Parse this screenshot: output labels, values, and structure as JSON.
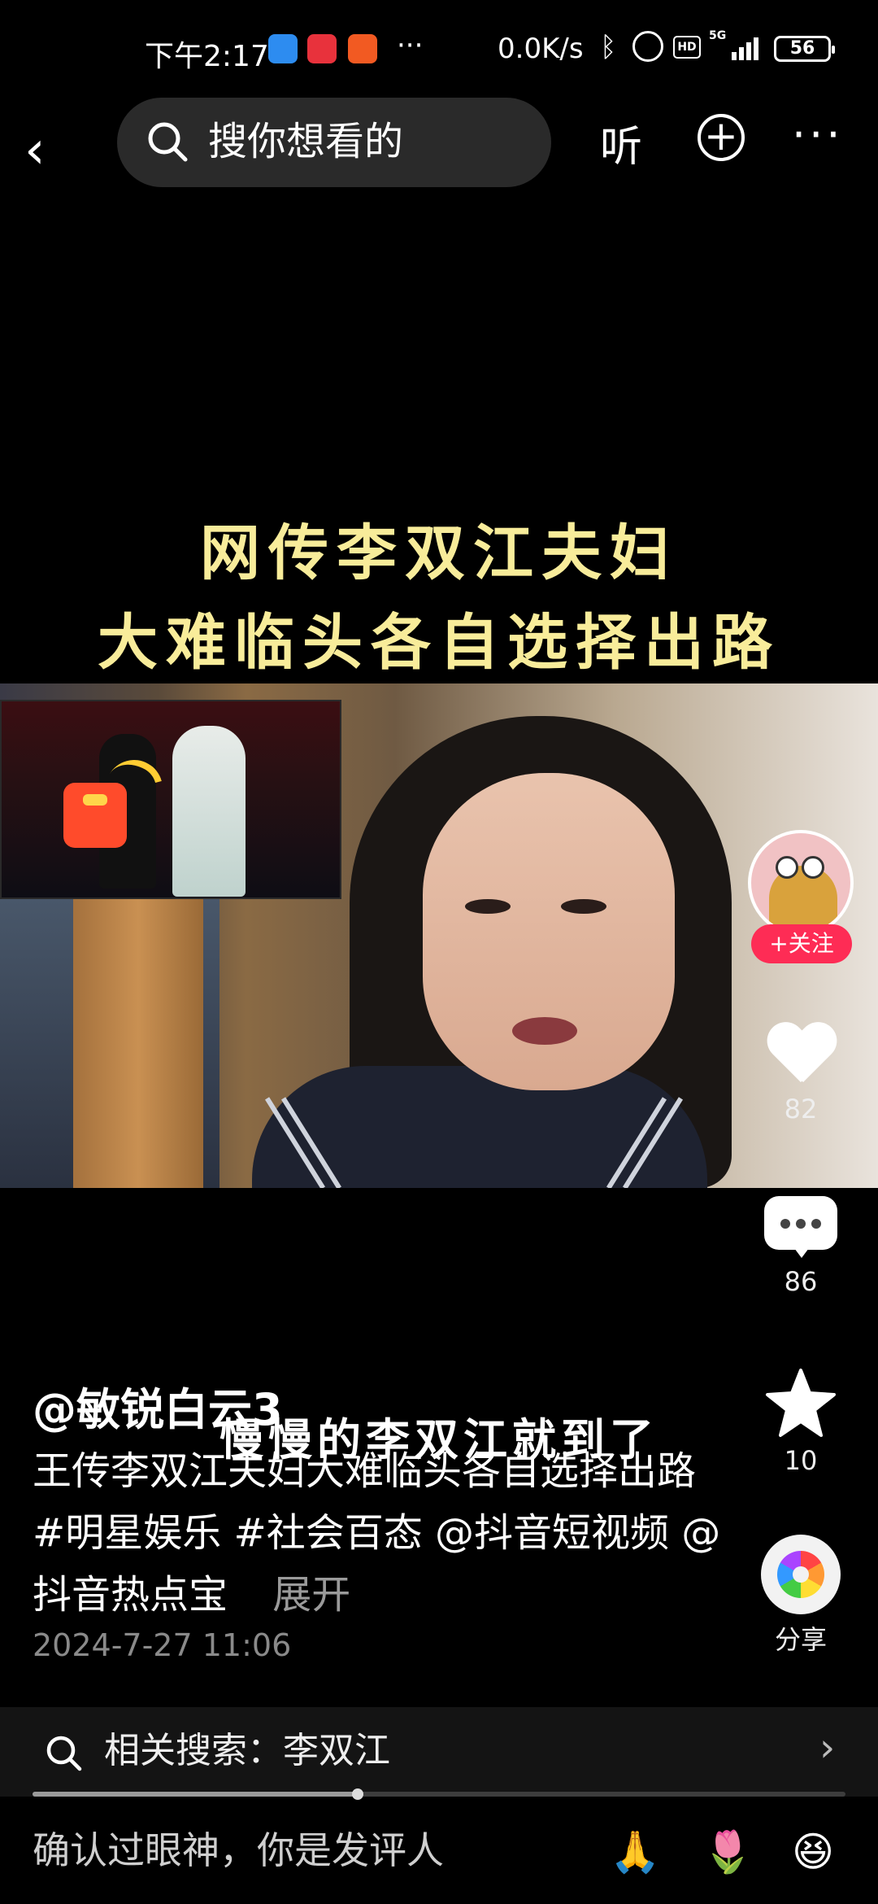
{
  "status_bar": {
    "time": "下午2:17",
    "more": "···",
    "net_speed": "0.0K/s",
    "network_type": "5G",
    "battery": "56"
  },
  "top_nav": {
    "back_icon": "‹",
    "search_placeholder": "搜你想看的",
    "listen_label": "听",
    "add_icon": "+",
    "more_icon": "···"
  },
  "video": {
    "caption_top_line1": "网传李双江夫妇",
    "caption_top_line2": "大难临头各自选择出路",
    "caption_bottom": "慢慢的李双江就到了"
  },
  "actions": {
    "follow_label": "+关注",
    "likes": "82",
    "comments": "86",
    "favorites": "10",
    "share_label": "分享"
  },
  "post": {
    "author": "@敏锐白云3",
    "desc_text": "王传李双江夫妇大难临头各自选择出路",
    "hashtag1": "#明星娱乐",
    "hashtag2": "#社会百态",
    "mention1": "@抖音短视频",
    "mention2": "@抖音热点宝",
    "expand_label": "展开",
    "date": "2024-7-27 11:06"
  },
  "related_search": {
    "text": "相关搜索：李双江",
    "chevron": "›"
  },
  "progress": {
    "played_fraction": 0.4
  },
  "comment_bar": {
    "placeholder": "确认过眼神，你是发评人",
    "emoji1": "🙏",
    "emoji2": "🌷",
    "emoji3": "😆"
  }
}
